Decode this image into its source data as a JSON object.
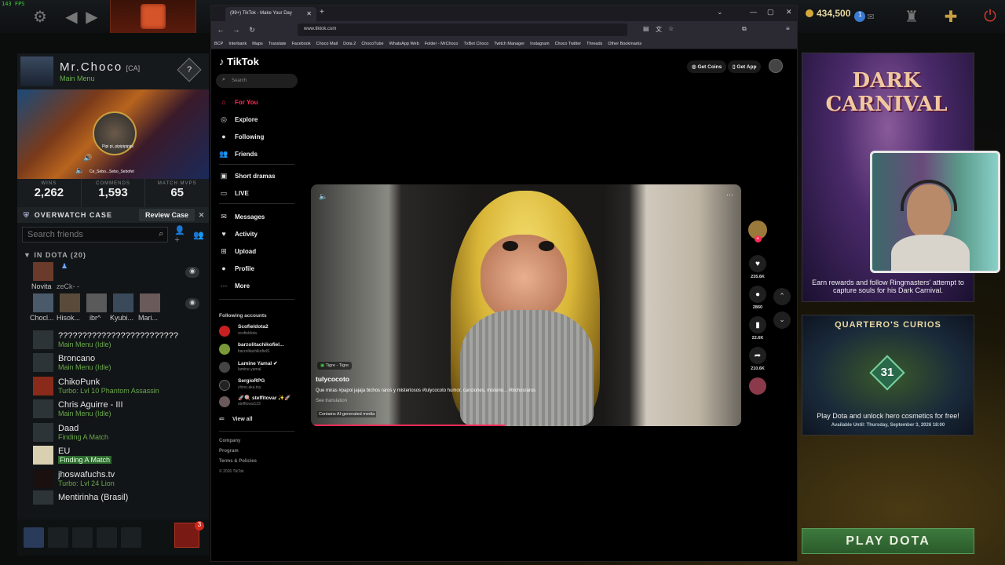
{
  "hud": {
    "fps": "143 FPS",
    "gold": "434,500",
    "notif_count": "1"
  },
  "profile": {
    "name": "Mr.Choco",
    "tag": "[CA]",
    "status": "Main Menu",
    "help": "?",
    "webcam_caption": "Ce_Sebo...Sebo_Sebofet",
    "webcam_line": "Pipi pi, pipipipipipi",
    "stats": [
      {
        "label": "WINS",
        "value": "2,262"
      },
      {
        "label": "COMMENDS",
        "value": "1,593"
      },
      {
        "label": "MATCH MVPS",
        "value": "65"
      }
    ]
  },
  "overwatch": {
    "label": "OVERWATCH CASE",
    "button": "Review Case"
  },
  "friends": {
    "search_placeholder": "Search friends",
    "group_label": "IN DOTA (20)",
    "party_row1": [
      {
        "name": "Novita",
        "extra": "zeCk-  -"
      }
    ],
    "party_row2": [
      "Chocl...",
      "Hisok...",
      "ibr^",
      "Kyubi...",
      "Mari..."
    ],
    "list": [
      {
        "name": "?????????????????????????",
        "status": "Main Menu (Idle)"
      },
      {
        "name": "Broncano",
        "status": "Main Menu (Idle)"
      },
      {
        "name": "ChikoPunk",
        "status": "Turbo: Lvl 10 Phantom Assassin"
      },
      {
        "name": "Chris Aguirre - III",
        "status": "Main Menu (Idle)"
      },
      {
        "name": "Daad",
        "status": "Finding A Match"
      },
      {
        "name": "EU",
        "status": "Finding A Match"
      },
      {
        "name": "jhoswafuchs.tv",
        "status": "Turbo: Lvl 24 Lion"
      },
      {
        "name": "Mentirinha (Brasil)",
        "status": ""
      }
    ],
    "party_badge": "3"
  },
  "browser": {
    "tab_title": "(99+) TikTok - Make Your Day",
    "url": "www.tiktok.com",
    "bookmarks": [
      "BCP",
      "Interbank",
      "Maps",
      "Translate",
      "Facebook",
      "Choco Mail",
      "Dota 2",
      "ChocoTube",
      "WhatsApp Web",
      "Folder - MrChoco",
      "TxBet Choco",
      "Twitch Manager",
      "Instagram",
      "Choco Twitter",
      "Threads",
      "Other Bookmarks"
    ]
  },
  "tiktok": {
    "logo": "TikTok",
    "search_placeholder": "Search",
    "nav": [
      {
        "icon": "home-icon",
        "glyph": "⌂",
        "label": "For You"
      },
      {
        "icon": "compass-icon",
        "glyph": "◎",
        "label": "Explore"
      },
      {
        "icon": "following-icon",
        "glyph": "●",
        "label": "Following"
      },
      {
        "icon": "friends-icon",
        "glyph": "👥",
        "label": "Friends"
      },
      {
        "icon": "short-dramas-icon",
        "glyph": "▣",
        "label": "Short dramas"
      },
      {
        "icon": "live-icon",
        "glyph": "▭",
        "label": "LIVE"
      },
      {
        "icon": "messages-icon",
        "glyph": "✉",
        "label": "Messages"
      },
      {
        "icon": "activity-icon",
        "glyph": "♥",
        "label": "Activity"
      },
      {
        "icon": "upload-icon",
        "glyph": "⊞",
        "label": "Upload"
      },
      {
        "icon": "profile-icon",
        "glyph": "●",
        "label": "Profile"
      },
      {
        "icon": "more-icon",
        "glyph": "⋯",
        "label": "More"
      }
    ],
    "following_title": "Following accounts",
    "following": [
      {
        "name": "Scofieldota2",
        "handle": "scofieldota"
      },
      {
        "name": "barzolitachikofiel...",
        "handle": "barzolitachikofielS"
      },
      {
        "name": "Lamine Yamal ✔",
        "handle": "lamine.yamal"
      },
      {
        "name": "SergioRPG",
        "handle": "chino.aka.toy"
      },
      {
        "name": "🚀🍭 steffitovar ✨🚀",
        "handle": "stefftovar123"
      }
    ],
    "view_all": "View all",
    "footer": [
      "Company",
      "Program",
      "Terms & Policies"
    ],
    "copyright": "© 2026 TikTok",
    "get_coins": "Get Coins",
    "get_app": "Get App",
    "video": {
      "music": "Tigre - Tigre",
      "username": "tulycocoto",
      "description": "Que miras #papoi jajaja bichos raros y misteriosos #tulycocoto humor, canciones, misterio... #bichosraros",
      "see_translation": "See translation",
      "ai_label": "Contains AI-generated media",
      "progress": 0.45
    },
    "actions": [
      {
        "name": "like",
        "glyph": "♥",
        "count": "235.6K"
      },
      {
        "name": "comment",
        "glyph": "●",
        "count": "2860"
      },
      {
        "name": "save",
        "glyph": "▮",
        "count": "22.6K"
      },
      {
        "name": "share",
        "glyph": "➦",
        "count": "210.6K"
      }
    ]
  },
  "right_panel": {
    "event_title_1": "DARK",
    "event_title_2": "CARNIVAL",
    "event_text": "Earn rewards and follow Ringmasters' attempt to capture souls for his Dark Carnival.",
    "curios_title": "QUARTERO'S CURIOS",
    "curios_number": "31",
    "curios_text": "Play Dota and unlock hero cosmetics for free!",
    "curios_avail": "Available Until:  Thursday, September 3, 2026 18:00",
    "play_button": "PLAY DOTA"
  }
}
